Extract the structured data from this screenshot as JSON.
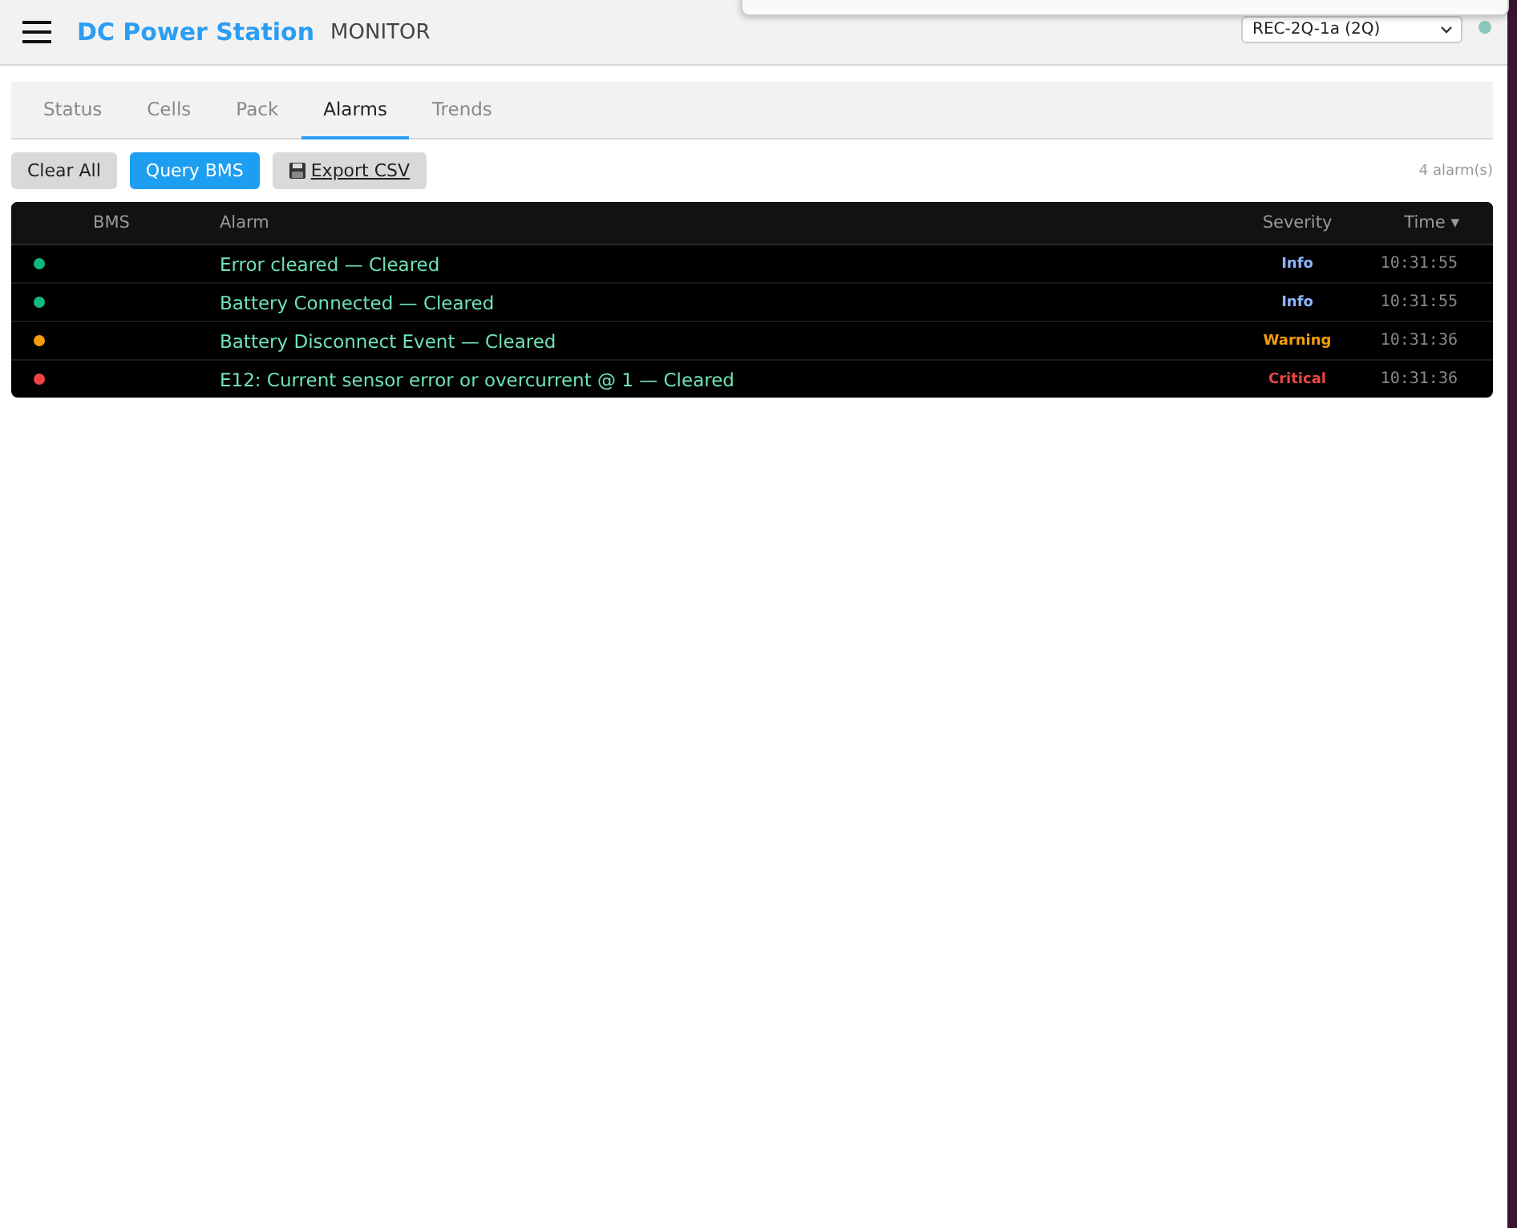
{
  "header": {
    "title": "DC Power Station",
    "subtitle": "MONITOR",
    "device_select": {
      "value": "REC-2Q-1a (2Q)"
    },
    "connection": {
      "color": "#8fc7bd"
    }
  },
  "tabs": [
    {
      "label": "Status",
      "selected": false
    },
    {
      "label": "Cells",
      "selected": false
    },
    {
      "label": "Pack",
      "selected": false
    },
    {
      "label": "Alarms",
      "selected": true
    },
    {
      "label": "Trends",
      "selected": false
    }
  ],
  "toolbar": {
    "buttons": [
      {
        "label": "Clear All",
        "kind": "plain"
      },
      {
        "label": "Query BMS",
        "kind": "primary"
      },
      {
        "label": "Export CSV",
        "kind": "export"
      }
    ],
    "count": "4 alarm(s)"
  },
  "table": {
    "columns": [
      {
        "label": "BMS"
      },
      {
        "label": "Alarm"
      },
      {
        "label": "Severity"
      },
      {
        "label": "Time",
        "sort": "▾"
      }
    ],
    "rows": [
      {
        "color": "#10b981",
        "alarm": "Error cleared — Cleared",
        "severity": "Info",
        "kind": "info",
        "time": "10:31:55"
      },
      {
        "color": "#10b981",
        "alarm": "Battery Connected — Cleared",
        "severity": "Info",
        "kind": "info",
        "time": "10:31:55"
      },
      {
        "color": "#f59e0b",
        "alarm": "Battery Disconnect Event — Cleared",
        "severity": "Warning",
        "kind": "warning",
        "time": "10:31:36"
      },
      {
        "color": "#ef4444",
        "alarm": "E12: Current sensor error or overcurrent @ 1 — Cleared",
        "severity": "Critical",
        "kind": "critical",
        "time": "10:31:36"
      }
    ]
  }
}
